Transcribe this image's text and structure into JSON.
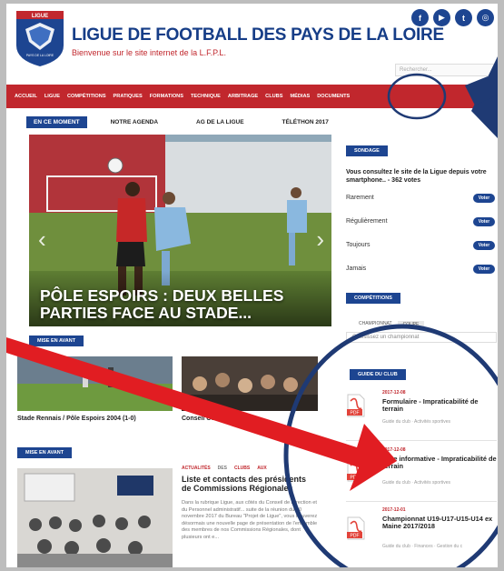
{
  "brand": {
    "logo_text": "LIGUE",
    "logo_sub": "PAYS DE LA LOIRE",
    "title": "LIGUE DE FOOTBALL DES PAYS DE LA LOIRE",
    "subtitle": "Bienvenue sur le site internet de la L.F.P.L."
  },
  "socials": [
    {
      "icon": "facebook-icon",
      "glyph": "f"
    },
    {
      "icon": "youtube-icon",
      "glyph": "▶"
    },
    {
      "icon": "twitter-icon",
      "glyph": "t"
    },
    {
      "icon": "instagram-icon",
      "glyph": "◎"
    }
  ],
  "search": {
    "placeholder": "Rechercher..."
  },
  "nav": [
    "Accueil",
    "Ligue",
    "Compétitions",
    "Pratiques",
    "Formations",
    "Technique",
    "Arbitrage",
    "Clubs",
    "Médias",
    "Documents"
  ],
  "tabs": [
    "EN CE MOMENT",
    "NOTRE AGENDA",
    "AG DE LA LIGUE",
    "TÉLÉTHON 2017"
  ],
  "hero": {
    "caption": "PÔLE ESPOIRS : DEUX BELLES PARTIES FACE AU STADE..."
  },
  "mise_en_avant_1": {
    "header": "MISE EN AVANT",
    "items": [
      {
        "caption": "Stade Rennais / Pôle Espoirs 2004 (1-0)"
      },
      {
        "caption": "Conseil Con"
      }
    ]
  },
  "mise_en_avant_2": {
    "header": "MISE EN AVANT",
    "tags": [
      "Actualités",
      "Clubs",
      "Aux"
    ],
    "tag_gap": "des",
    "title": "Liste et contacts des présidents de Commissions Régionales",
    "body": "Dans la rubrique Ligue, aux côtés du Conseil de Direction et du Personnel administratif... suite de la réunion du 20 novembre 2017 du Bureau \"Projet de Ligue\", vous trouverez désormais une nouvelle page de présentation de l'ensemble des membres de nos Commissions Régionales, dont plusieurs ont e..."
  },
  "sondage": {
    "header": "SONDAGE",
    "question": "Vous consultez le site de la Ligue depuis votre smartphone.. - 362 votes",
    "options": [
      "Rarement",
      "Régulièrement",
      "Toujours",
      "Jamais"
    ],
    "vote_label": "Voter"
  },
  "competitions": {
    "header": "COMPÉTITIONS",
    "tabs": [
      "CHAMPIONNAT",
      "COUPE"
    ],
    "select_placeholder": "Choisissez un championnat"
  },
  "guide": {
    "header": "GUIDE DU CLUB",
    "items": [
      {
        "date": "2017-12-08",
        "title": "Formulaire - Impraticabilité de terrain",
        "meta": "Guide du club · Activités sportives"
      },
      {
        "date": "2017-12-08",
        "title": "Note informative - Impraticabilité de terrain",
        "meta": "Guide du club · Activités sportives"
      },
      {
        "date": "2017-12-01",
        "title": "Championnat U19-U17-U15-U14 ex Maine 2017/2018",
        "meta": "Guide du club · Finances · Gestion du c"
      }
    ],
    "pdf_label": "PDF"
  },
  "colors": {
    "brand_blue": "#1d4591",
    "brand_red": "#c1272d",
    "annotation_navy": "#1f3a74",
    "annotation_red": "#e11d22"
  }
}
